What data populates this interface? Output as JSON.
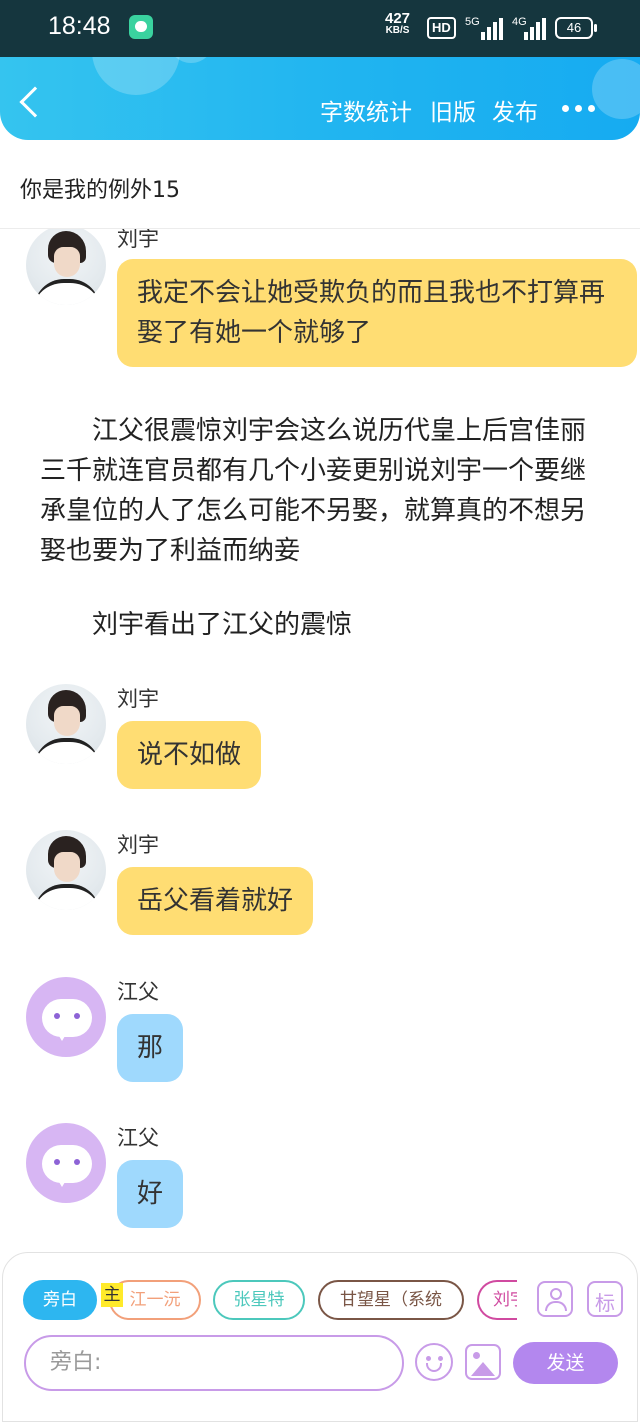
{
  "status_bar": {
    "time": "18:48",
    "net_speed_value": "427",
    "net_speed_unit": "KB/S",
    "hd_label": "HD",
    "signal1_label": "5G",
    "signal2_label": "4G",
    "battery": "46"
  },
  "header": {
    "word_count_label": "字数统计",
    "old_version_label": "旧版",
    "publish_label": "发布"
  },
  "story": {
    "title": "你是我的例外15"
  },
  "messages": [
    {
      "type": "dialogue",
      "speaker": "刘宇",
      "text": "我定不会让她受欺负的而且我也不打算再娶了有她一个就够了"
    },
    {
      "type": "narration",
      "text": "江父很震惊刘宇会这么说历代皇上后宫佳丽三千就连官员都有几个小妾更别说刘宇一个要继承皇位的人了怎么可能不另娶，就算真的不想另娶也要为了利益而纳妾"
    },
    {
      "type": "narration",
      "text": "刘宇看出了江父的震惊"
    },
    {
      "type": "dialogue",
      "speaker": "刘宇",
      "text": "说不如做"
    },
    {
      "type": "dialogue",
      "speaker": "刘宇",
      "text": "岳父看着就好"
    },
    {
      "type": "dialogue",
      "speaker": "江父",
      "text": "那"
    },
    {
      "type": "dialogue",
      "speaker": "江父",
      "text": "好"
    }
  ],
  "composer": {
    "roles": [
      "旁白",
      "江一沅",
      "张星特",
      "甘望星（系统",
      "刘宇"
    ],
    "main_tag": "主",
    "tag_button_label": "标",
    "input_placeholder": "旁白:",
    "send_label": "发送"
  },
  "colors": {
    "header_blue": "#20b4f0",
    "bubble_yellow": "#ffdd73",
    "bubble_blue": "#9fd9fd",
    "accent_purple": "#b387ee",
    "selected_role": "#2db6f0"
  }
}
